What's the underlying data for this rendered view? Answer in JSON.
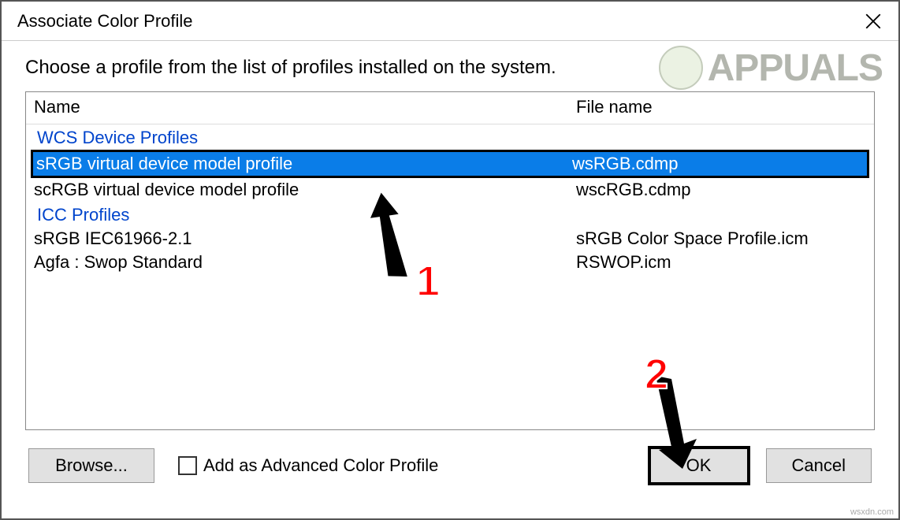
{
  "window": {
    "title": "Associate Color Profile"
  },
  "instruction": "Choose a profile from the list of profiles installed on the system.",
  "columns": {
    "name": "Name",
    "filename": "File name"
  },
  "groups": {
    "wcs": "WCS Device Profiles",
    "icc": "ICC Profiles"
  },
  "rows": {
    "r1": {
      "name": "sRGB virtual device model profile",
      "file": "wsRGB.cdmp"
    },
    "r2": {
      "name": "scRGB virtual device model profile",
      "file": "wscRGB.cdmp"
    },
    "r3": {
      "name": "sRGB IEC61966-2.1",
      "file": "sRGB Color Space Profile.icm"
    },
    "r4": {
      "name": "Agfa : Swop Standard",
      "file": "RSWOP.icm"
    }
  },
  "buttons": {
    "browse": "Browse...",
    "ok": "OK",
    "cancel": "Cancel"
  },
  "checkbox": {
    "label": "Add as Advanced Color Profile"
  },
  "watermark": {
    "text": "APPUALS"
  },
  "annotations": {
    "n1": "1",
    "n2": "2"
  },
  "tag": "wsxdn.com"
}
